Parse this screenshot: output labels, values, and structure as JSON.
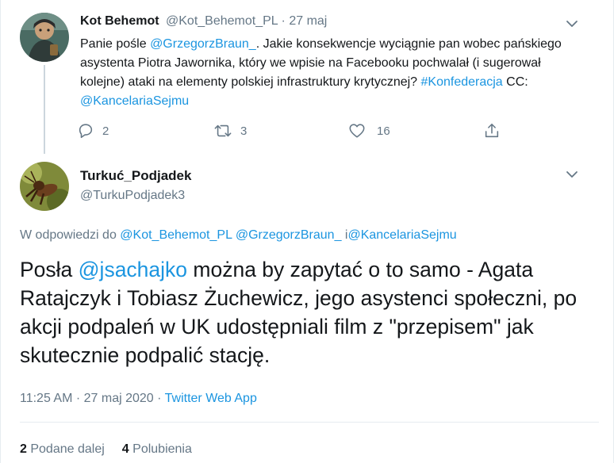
{
  "colors": {
    "link": "#1b95e0",
    "secondary_text": "#657786",
    "primary_text": "#14171a",
    "divider": "#e6ecf0",
    "thread_line": "#ccd6dd"
  },
  "parent_tweet": {
    "avatar_icon": "user-avatar-icon",
    "display_name": "Kot Behemot",
    "handle": "@Kot_Behemot_PL",
    "separator": "·",
    "date": "27 maj",
    "text_1": "Panie pośle ",
    "mention_1": "@GrzegorzBraun_",
    "text_2": ". Jakie konsekwencje wyciągnie pan wobec pańskiego asystenta Piotra Jawornika, który we wpisie na Facebooku pochwalał (i sugerował kolejne) ataki na elementy polskiej infrastruktury krytycznej? ",
    "hashtag": "#Konfederacja",
    "text_3": " CC: ",
    "mention_2": "@KancelariaSejmu",
    "actions": {
      "reply_count": "2",
      "retweet_count": "3",
      "like_count": "16"
    }
  },
  "reply_tweet": {
    "avatar_icon": "user-avatar-icon",
    "display_name": "Turkuć_Podjadek",
    "handle": "@TurkuPodjadek3",
    "reply_to_prefix": "W odpowiedzi do ",
    "reply_to_1": "@Kot_Behemot_PL",
    "reply_to_2": "@GrzegorzBraun_",
    "reply_to_joiner": " i",
    "reply_to_3": "@KancelariaSejmu",
    "text_1": "Posła ",
    "mention": "@jsachajko",
    "text_2": " można by zapytać o to samo - Agata Ratajczyk i Tobiasz Żuchewicz, jego asystenci społeczni, po akcji podpaleń w UK udostępniali film z \"przepisem\" jak skutecznie podpalić stację.",
    "time": "11:25 AM",
    "meta_sep_1": " · ",
    "date": "27 maj 2020",
    "meta_sep_2": " · ",
    "app": "Twitter Web App",
    "retweets_count": "2",
    "retweets_label": "Podane dalej",
    "likes_count": "4",
    "likes_label": "Polubienia"
  }
}
